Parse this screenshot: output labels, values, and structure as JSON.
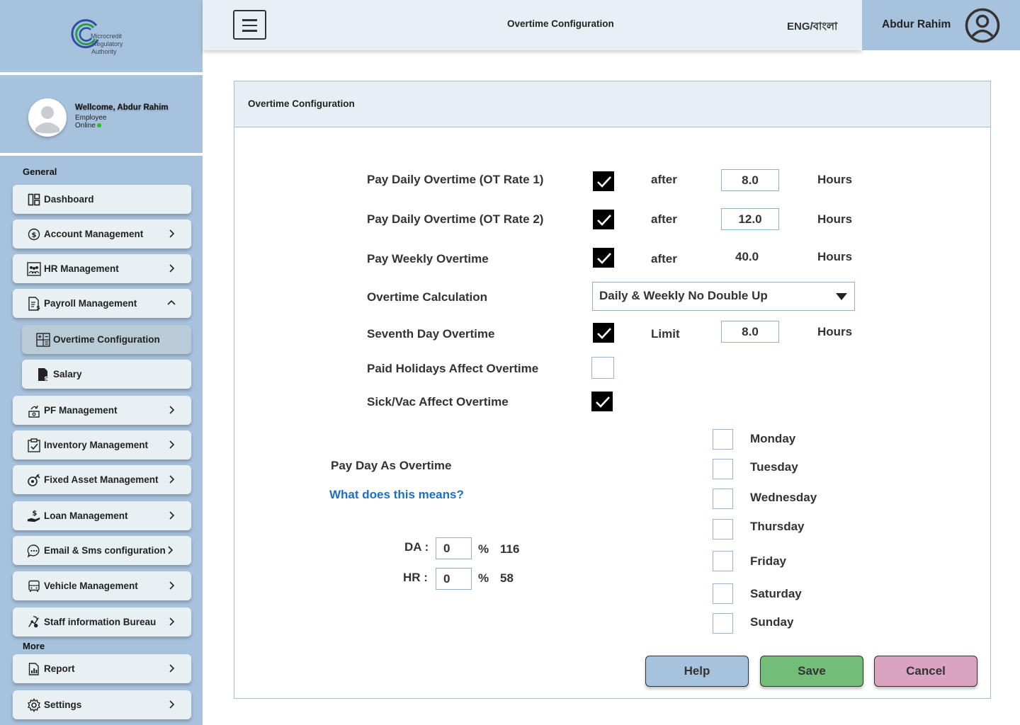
{
  "header": {
    "title": "Overtime Configuration",
    "language": "ENG/বাংলা",
    "user_name": "Abdur Rahim"
  },
  "logo": {
    "line1": "Microcredit",
    "line2": "Regulatory",
    "line3": "Authority",
    "colors": {
      "green": "#2e9b4a",
      "blue": "#2a4fa0"
    }
  },
  "profile": {
    "welcome": "Wellcome, Abdur Rahim",
    "role": "Employee",
    "status": "Online"
  },
  "sidebar": {
    "general_label": "General",
    "more_label": "More",
    "items": [
      {
        "label": "Dashboard",
        "icon": "dashboard-icon"
      },
      {
        "label": "Account Management",
        "icon": "dollar-circle-icon"
      },
      {
        "label": "HR Management",
        "icon": "people-icon"
      },
      {
        "label": "Payroll Management",
        "icon": "payroll-icon"
      },
      {
        "label": "Overtime Configuration",
        "icon": "calculator-icon"
      },
      {
        "label": "Salary",
        "icon": "salary-doc-icon"
      },
      {
        "label": "PF Management",
        "icon": "pf-icon"
      },
      {
        "label": "Inventory Management",
        "icon": "clipboard-check-icon"
      },
      {
        "label": "Fixed Asset Management",
        "icon": "asset-tag-icon"
      },
      {
        "label": "Loan Management",
        "icon": "hand-dollar-icon"
      },
      {
        "label": "Email & Sms configuration",
        "icon": "chat-icon"
      },
      {
        "label": "Vehicle Management",
        "icon": "bus-icon"
      },
      {
        "label": "Staff information Bureau",
        "icon": "bureau-icon"
      },
      {
        "label": "Report",
        "icon": "report-icon"
      },
      {
        "label": "Settings",
        "icon": "gear-icon"
      }
    ]
  },
  "panel": {
    "title": "Overtime Configuration",
    "rows": {
      "ot1": {
        "label": "Pay Daily Overtime (OT Rate 1)",
        "checked": true,
        "connector": "after",
        "value": "8.0",
        "unit": "Hours"
      },
      "ot2": {
        "label": "Pay Daily Overtime (OT Rate 2)",
        "checked": true,
        "connector": "after",
        "value": "12.0",
        "unit": "Hours"
      },
      "weekly": {
        "label": "Pay Weekly Overtime",
        "checked": true,
        "connector": "after",
        "value": "40.0",
        "unit": "Hours"
      },
      "calc": {
        "label": "Overtime Calculation",
        "value": "Daily & Weekly No Double Up"
      },
      "seventh": {
        "label": "Seventh Day Overtime",
        "checked": true,
        "connector": "Limit",
        "value": "8.0",
        "unit": "Hours"
      },
      "holidays": {
        "label": "Paid Holidays Affect Overtime",
        "checked": false
      },
      "sickvac": {
        "label": "Sick/Vac Affect Overtime",
        "checked": true
      }
    },
    "pay_day_label": "Pay Day As Overtime",
    "help_link": "What does this means?",
    "days": [
      "Monday",
      "Tuesday",
      "Wednesday",
      "Thursday",
      "Friday",
      "Saturday",
      "Sunday"
    ],
    "da": {
      "label": "DA :",
      "value": "0",
      "unit": "%",
      "amount": "116"
    },
    "hr": {
      "label": "HR :",
      "value": "0",
      "unit": "%",
      "amount": "58"
    },
    "buttons": {
      "help": "Help",
      "save": "Save",
      "cancel": "Cancel"
    },
    "button_colors": {
      "help": "#a7c2dc",
      "save": "#72bd78",
      "cancel": "#d9a3c1"
    }
  }
}
